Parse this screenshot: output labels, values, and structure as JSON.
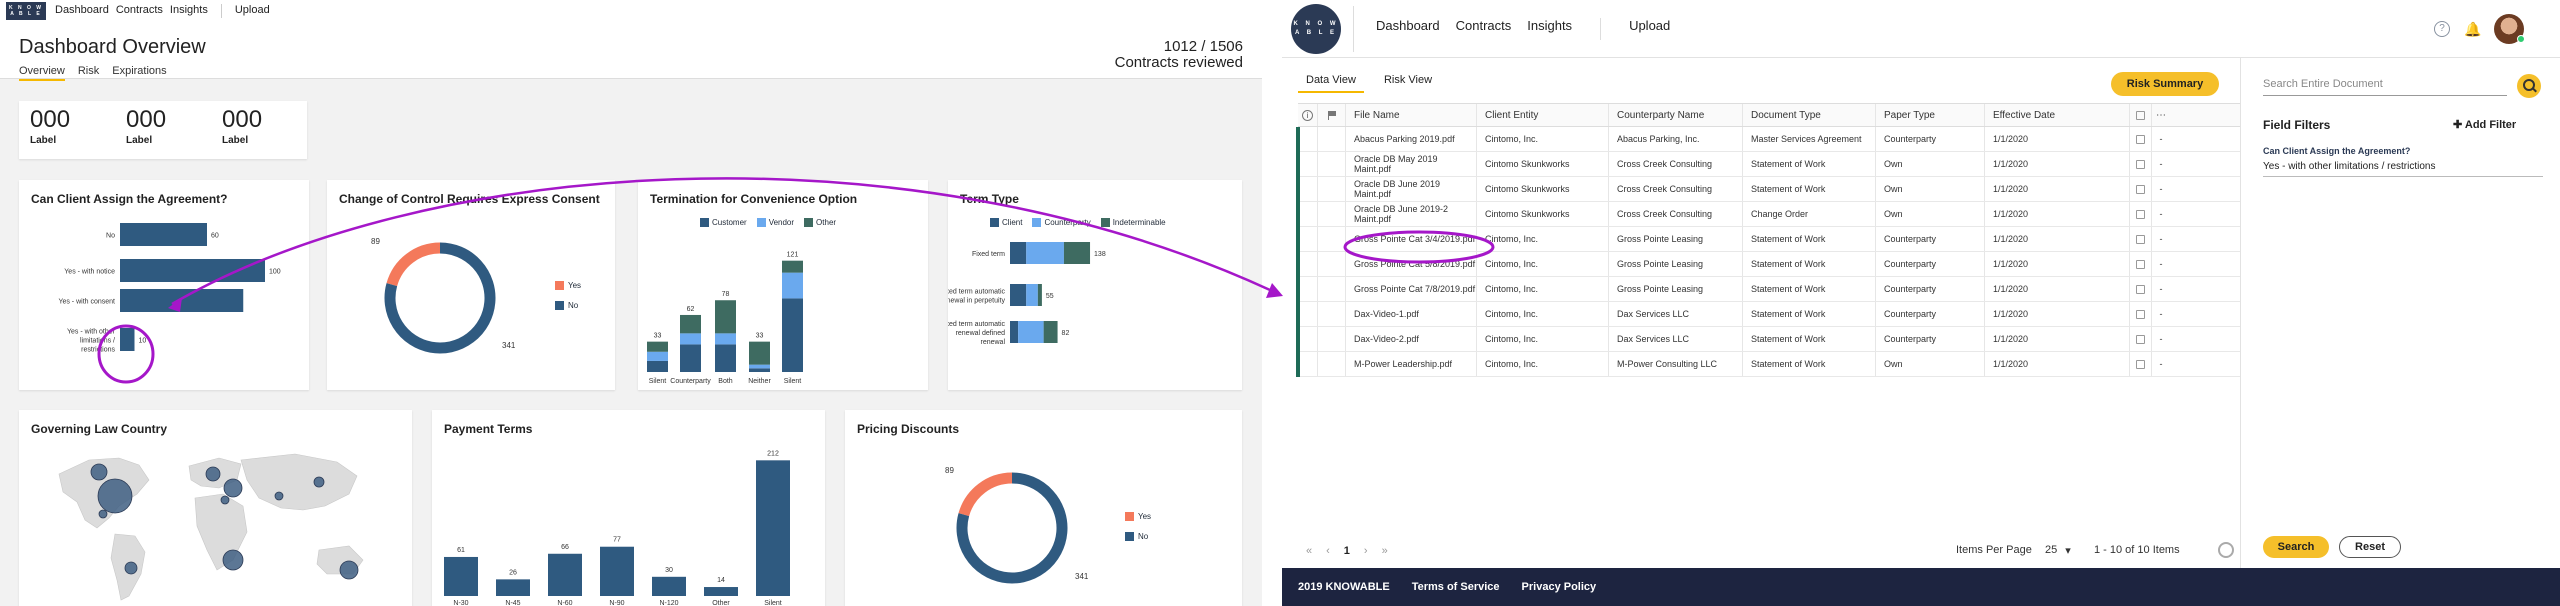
{
  "dashboard": {
    "logo_text": "KNOWABLE",
    "nav": [
      "Dashboard",
      "Contracts",
      "Insights"
    ],
    "upload": "Upload",
    "title": "Dashboard Overview",
    "tabs": [
      "Overview",
      "Risk",
      "Expirations"
    ],
    "count": "1012 / 1506",
    "count_label": "Contracts reviewed",
    "stats": [
      {
        "num": "000",
        "label": "Label"
      },
      {
        "num": "000",
        "label": "Label"
      },
      {
        "num": "000",
        "label": "Label"
      }
    ]
  },
  "charts": {
    "assign": {
      "title": "Can Client Assign the Agreement?"
    },
    "control": {
      "title": "Change of Control Requires Express Consent",
      "yes": "Yes",
      "no": "No",
      "yes_val": "89",
      "no_val": "341"
    },
    "termination": {
      "title": "Termination for Convenience Option",
      "legend": [
        "Customer",
        "Vendor",
        "Other"
      ]
    },
    "term_type": {
      "title": "Term Type",
      "legend": [
        "Client",
        "Counterparty",
        "Indeterminable"
      ]
    },
    "gov_law": {
      "title": "Governing Law Country"
    },
    "payment": {
      "title": "Payment Terms"
    },
    "pricing": {
      "title": "Pricing Discounts",
      "yes": "Yes",
      "no": "No",
      "yes_val": "89",
      "no_val": "341"
    }
  },
  "chart_data": [
    {
      "type": "bar",
      "orientation": "horizontal",
      "title": "Can Client Assign the Agreement?",
      "categories": [
        "No",
        "Yes - with notice",
        "Yes - with consent",
        "Yes - with other limitations / restrictions"
      ],
      "values": [
        60,
        100,
        85,
        10
      ],
      "value_labels": [
        "60",
        "100",
        "",
        "10"
      ]
    },
    {
      "type": "pie",
      "style": "donut",
      "title": "Change of Control Requires Express Consent",
      "categories": [
        "Yes",
        "No"
      ],
      "values": [
        89,
        341
      ],
      "colors": [
        "#f4795b",
        "#2f5a80"
      ]
    },
    {
      "type": "bar",
      "stacked": true,
      "title": "Termination for Convenience Option",
      "categories": [
        "Silent",
        "Counterparty",
        "Both",
        "Neither",
        "Silent"
      ],
      "totals": [
        33,
        62,
        78,
        33,
        121
      ],
      "series": [
        {
          "name": "Customer",
          "values": [
            12,
            30,
            30,
            4,
            80
          ]
        },
        {
          "name": "Vendor",
          "values": [
            10,
            12,
            12,
            4,
            28
          ]
        },
        {
          "name": "Other",
          "values": [
            11,
            20,
            36,
            25,
            13
          ]
        }
      ],
      "colors": [
        "#2f5a80",
        "#6aa9ee",
        "#3e6b61"
      ]
    },
    {
      "type": "bar",
      "orientation": "horizontal",
      "stacked": true,
      "title": "Term Type",
      "categories": [
        "Fixed term",
        "Fixed term automatic renewal in perpetuity",
        "Fixed term automatic renewal defined renewal"
      ],
      "totals": [
        138,
        55,
        82
      ],
      "series": [
        {
          "name": "Client",
          "values": [
            28,
            28,
            14
          ]
        },
        {
          "name": "Counterparty",
          "values": [
            65,
            20,
            44
          ]
        },
        {
          "name": "Indeterminable",
          "values": [
            45,
            7,
            24
          ]
        }
      ],
      "colors": [
        "#2f5a80",
        "#6aa9ee",
        "#3e6b61"
      ]
    },
    {
      "type": "bar",
      "title": "Payment Terms",
      "categories": [
        "N-30",
        "N-45",
        "N-60",
        "N-90",
        "N-120",
        "Other",
        "Silent"
      ],
      "values": [
        61,
        26,
        66,
        77,
        30,
        14,
        212
      ]
    },
    {
      "type": "pie",
      "style": "donut",
      "title": "Pricing Discounts",
      "categories": [
        "Yes",
        "No"
      ],
      "values": [
        89,
        341
      ],
      "colors": [
        "#f4795b",
        "#2f5a80"
      ]
    }
  ],
  "app": {
    "logo_text": "KNOWABLE",
    "nav": [
      "Dashboard",
      "Contracts",
      "Insights"
    ],
    "upload": "Upload",
    "view_tabs": [
      "Data View",
      "Risk View"
    ],
    "risk_summary": "Risk Summary",
    "columns": [
      "File Name",
      "Client Entity",
      "Counterparty Name",
      "Document Type",
      "Paper Type",
      "Effective Date"
    ],
    "rows": [
      {
        "file": "Abacus Parking 2019.pdf",
        "client": "Cintomo, Inc.",
        "cp": "Abacus Parking, Inc.",
        "doc": "Master Services Agreement",
        "paper": "Counterparty",
        "date": "1/1/2020"
      },
      {
        "file": "Oracle DB May 2019 Maint.pdf",
        "client": "Cintomo Skunkworks",
        "cp": "Cross Creek Consulting",
        "doc": "Statement of Work",
        "paper": "Own",
        "date": "1/1/2020"
      },
      {
        "file": "Oracle DB June 2019 Maint.pdf",
        "client": "Cintomo Skunkworks",
        "cp": "Cross Creek Consulting",
        "doc": "Statement of Work",
        "paper": "Own",
        "date": "1/1/2020"
      },
      {
        "file": "Oracle DB June 2019-2 Maint.pdf",
        "client": "Cintomo Skunkworks",
        "cp": "Cross Creek Consulting",
        "doc": "Change Order",
        "paper": "Own",
        "date": "1/1/2020"
      },
      {
        "file": "Gross Pointe Cat 3/4/2019.pdf",
        "client": "Cintomo, Inc.",
        "cp": "Gross Pointe Leasing",
        "doc": "Statement of Work",
        "paper": "Counterparty",
        "date": "1/1/2020"
      },
      {
        "file": "Gross Pointe Cat 5/8/2019.pdf",
        "client": "Cintomo, Inc.",
        "cp": "Gross Pointe Leasing",
        "doc": "Statement of Work",
        "paper": "Counterparty",
        "date": "1/1/2020"
      },
      {
        "file": "Gross Pointe Cat 7/8/2019.pdf",
        "client": "Cintomo, Inc.",
        "cp": "Gross Pointe Leasing",
        "doc": "Statement of Work",
        "paper": "Counterparty",
        "date": "1/1/2020"
      },
      {
        "file": "Dax-Video-1.pdf",
        "client": "Cintomo, Inc.",
        "cp": "Dax Services LLC",
        "doc": "Statement of Work",
        "paper": "Counterparty",
        "date": "1/1/2020"
      },
      {
        "file": "Dax-Video-2.pdf",
        "client": "Cintomo, Inc.",
        "cp": "Dax Services LLC",
        "doc": "Statement of Work",
        "paper": "Counterparty",
        "date": "1/1/2020"
      },
      {
        "file": "M-Power Leadership.pdf",
        "client": "Cintomo, Inc.",
        "cp": "M-Power Consulting LLC",
        "doc": "Statement of Work",
        "paper": "Own",
        "date": "1/1/2020"
      }
    ],
    "pager": {
      "current": "1",
      "items_label": "Items Per Page",
      "per_page": "25",
      "range": "1 - 10 of 10 Items"
    },
    "search_placeholder": "Search Entire Document",
    "field_filters": "Field Filters",
    "add_filter": "Add Filter",
    "filter_question": "Can Client Assign the Agreement?",
    "filter_answer": "Yes - with other limitations / restrictions",
    "search_btn": "Search",
    "reset_btn": "Reset",
    "footer": [
      "2019 KNOWABLE",
      "Terms of Service",
      "Privacy Policy"
    ]
  }
}
